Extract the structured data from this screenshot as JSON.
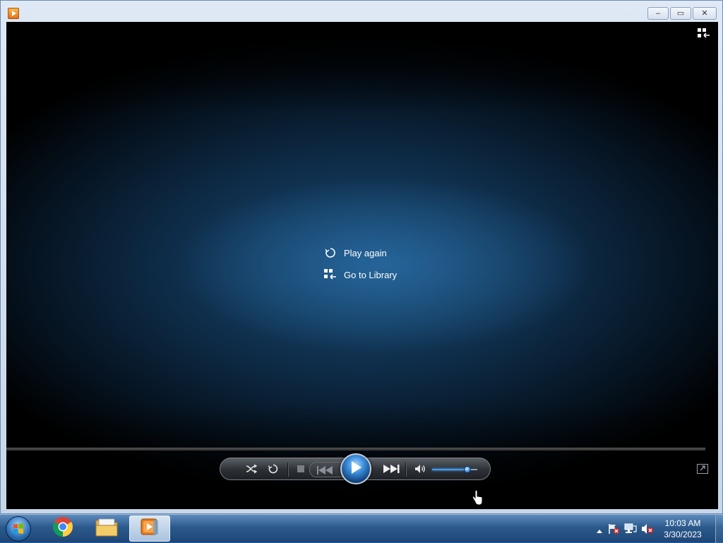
{
  "window": {
    "title": "",
    "buttons": {
      "minimize": "–",
      "maximize": "▭",
      "close": "✕"
    }
  },
  "player": {
    "menu": [
      {
        "label": "Play again",
        "icon": "replay-icon"
      },
      {
        "label": "Go to Library",
        "icon": "library-icon"
      }
    ],
    "volume_level": 0.78,
    "seek_progress": 1.0
  },
  "controls": {
    "shuffle": "shuffle-icon",
    "repeat": "repeat-icon",
    "stop": "stop-icon",
    "previous": "previous-icon",
    "play": "play-icon",
    "next": "next-icon",
    "mute": "volume-icon"
  },
  "taskbar": {
    "apps": [
      {
        "name": "chrome",
        "icon": "chrome-icon",
        "active": false
      },
      {
        "name": "file-explorer",
        "icon": "folder-icon",
        "active": false
      },
      {
        "name": "media-player",
        "icon": "media-player-icon",
        "active": true
      }
    ],
    "clock": {
      "time": "10:03 AM",
      "date": "3/30/2023"
    }
  },
  "colors": {
    "accent": "#3f9cff",
    "taskbar": "#2c5a8c"
  }
}
